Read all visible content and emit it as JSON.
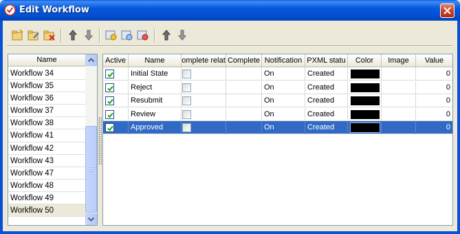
{
  "window": {
    "title": "Edit Workflow"
  },
  "toolbar": {
    "buttons": [
      "add-workflow-icon",
      "edit-workflow-icon",
      "delete-workflow-icon",
      "move-up-icon",
      "move-down-icon",
      "add-state-icon",
      "edit-state-icon",
      "delete-state-icon",
      "move-state-up-icon",
      "move-state-down-icon"
    ]
  },
  "workflows": {
    "header": "Name",
    "items": [
      "Workflow 34",
      "Workflow 35",
      "Workflow 36",
      "Workflow 37",
      "Workflow 38",
      "Workflow 41",
      "Workflow 42",
      "Workflow 43",
      "Workflow 47",
      "Workflow 48",
      "Workflow 49",
      "Workflow 50"
    ],
    "selected": "Workflow 50"
  },
  "states": {
    "columns": [
      "Active",
      "Name",
      "omplete relat",
      "Complete",
      "Notification",
      "PXML statu",
      "Color",
      "Image",
      "Value"
    ],
    "rows": [
      {
        "active": true,
        "name": "Initial State",
        "complete_related": false,
        "complete": "",
        "notification": "On",
        "pxml_status": "Created",
        "color": "#000000",
        "image": "",
        "value": "0"
      },
      {
        "active": true,
        "name": "Reject",
        "complete_related": false,
        "complete": "",
        "notification": "On",
        "pxml_status": "Created",
        "color": "#000000",
        "image": "",
        "value": "0"
      },
      {
        "active": true,
        "name": "Resubmit",
        "complete_related": false,
        "complete": "",
        "notification": "On",
        "pxml_status": "Created",
        "color": "#000000",
        "image": "",
        "value": "0"
      },
      {
        "active": true,
        "name": "Review",
        "complete_related": false,
        "complete": "",
        "notification": "On",
        "pxml_status": "Created",
        "color": "#000000",
        "image": "",
        "value": "0"
      },
      {
        "active": true,
        "name": "Approved",
        "complete_related": false,
        "complete": "",
        "notification": "On",
        "pxml_status": "Created",
        "color": "#000000",
        "image": "",
        "value": "0"
      }
    ],
    "selected_row": 4
  },
  "colors": {
    "title_bar": "#0458dc",
    "selection": "#316ac5",
    "dialog_bg": "#ece9d8"
  }
}
